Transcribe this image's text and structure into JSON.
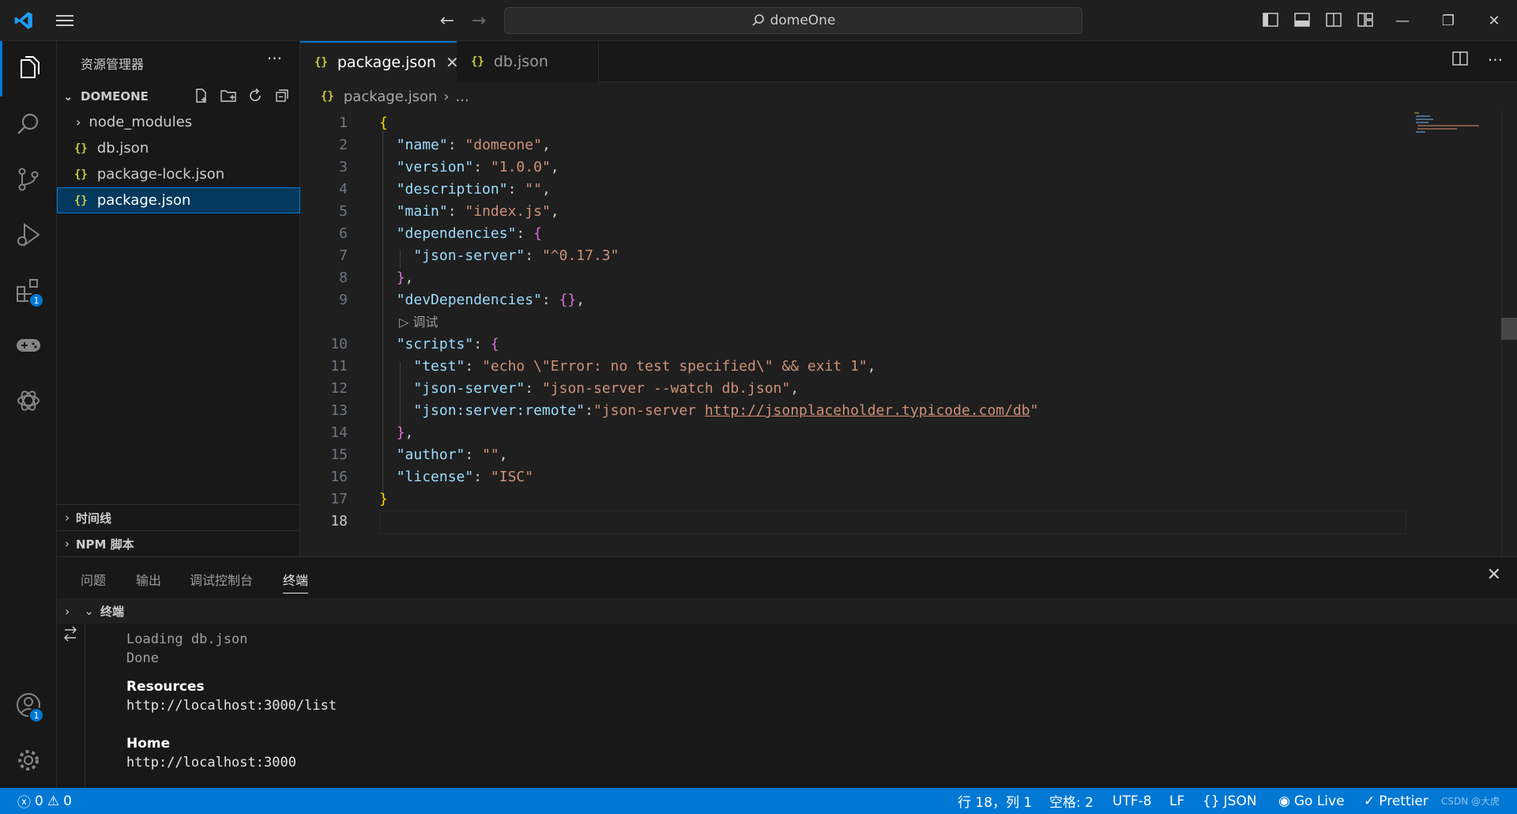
{
  "titlebar": {
    "search_text": "domeOne"
  },
  "activitybar": {
    "extensions_badge": "1",
    "accounts_badge": "1"
  },
  "sidebar": {
    "title": "资源管理器",
    "section": "DOMEONE",
    "items": [
      {
        "label": "node_modules",
        "type": "folder"
      },
      {
        "label": "db.json",
        "type": "json"
      },
      {
        "label": "package-lock.json",
        "type": "json"
      },
      {
        "label": "package.json",
        "type": "json",
        "selected": true
      }
    ],
    "timeline": "时间线",
    "npm": "NPM 脚本"
  },
  "tabs": [
    {
      "label": "package.json",
      "active": true,
      "icon": "{}"
    },
    {
      "label": "db.json",
      "active": false,
      "icon": "{}"
    }
  ],
  "breadcrumb": {
    "file": "package.json",
    "rest": "..."
  },
  "editor": {
    "codelens": "调试",
    "line_numbers": [
      "1",
      "2",
      "3",
      "4",
      "5",
      "6",
      "7",
      "8",
      "9",
      "10",
      "11",
      "12",
      "13",
      "14",
      "15",
      "16",
      "17",
      "18"
    ],
    "code": {
      "l1": "{",
      "l2k": "\"name\"",
      "l2v": "\"domeone\"",
      "l3k": "\"version\"",
      "l3v": "\"1.0.0\"",
      "l4k": "\"description\"",
      "l4v": "\"\"",
      "l5k": "\"main\"",
      "l5v": "\"index.js\"",
      "l6k": "\"dependencies\"",
      "l6b": "{",
      "l7k": "\"json-server\"",
      "l7v": "\"^0.17.3\"",
      "l8b": "}",
      "l9k": "\"devDependencies\"",
      "l9b": "{}",
      "l10k": "\"scripts\"",
      "l10b": "{",
      "l11k": "\"test\"",
      "l11v": "\"echo \\\"Error: no test specified\\\" && exit 1\"",
      "l12k": "\"json-server\"",
      "l12v": "\"json-server --watch db.json\"",
      "l13k": "\"json:server:remote\"",
      "l13v1": "\"json-server ",
      "l13link": "http://jsonplaceholder.typicode.com/db",
      "l13v2": "\"",
      "l14b": "}",
      "l15k": "\"author\"",
      "l15v": "\"\"",
      "l16k": "\"license\"",
      "l16v": "\"ISC\"",
      "l17": "}"
    }
  },
  "panel": {
    "tabs": [
      "问题",
      "输出",
      "调试控制台",
      "终端"
    ],
    "active_tab": "终端",
    "terminal_title": "终端",
    "lines": {
      "loading": "Loading db.json",
      "done": "Done",
      "resources": "Resources",
      "resources_url": "http://localhost:3000/list",
      "home": "Home",
      "home_url": "http://localhost:3000"
    }
  },
  "statusbar": {
    "errors": "0",
    "warnings": "0",
    "position": "行 18，列 1",
    "spaces": "空格: 2",
    "encoding": "UTF-8",
    "eol": "LF",
    "language": "JSON",
    "golive": "Go Live",
    "prettier": "Prettier",
    "watermark": "CSDN @大虎"
  },
  "colors": {
    "accent": "#0078d4",
    "json_key": "#9cdcfe",
    "json_string": "#ce9178",
    "bracket_gold": "#ffd700",
    "bracket_pink": "#da70d6"
  }
}
